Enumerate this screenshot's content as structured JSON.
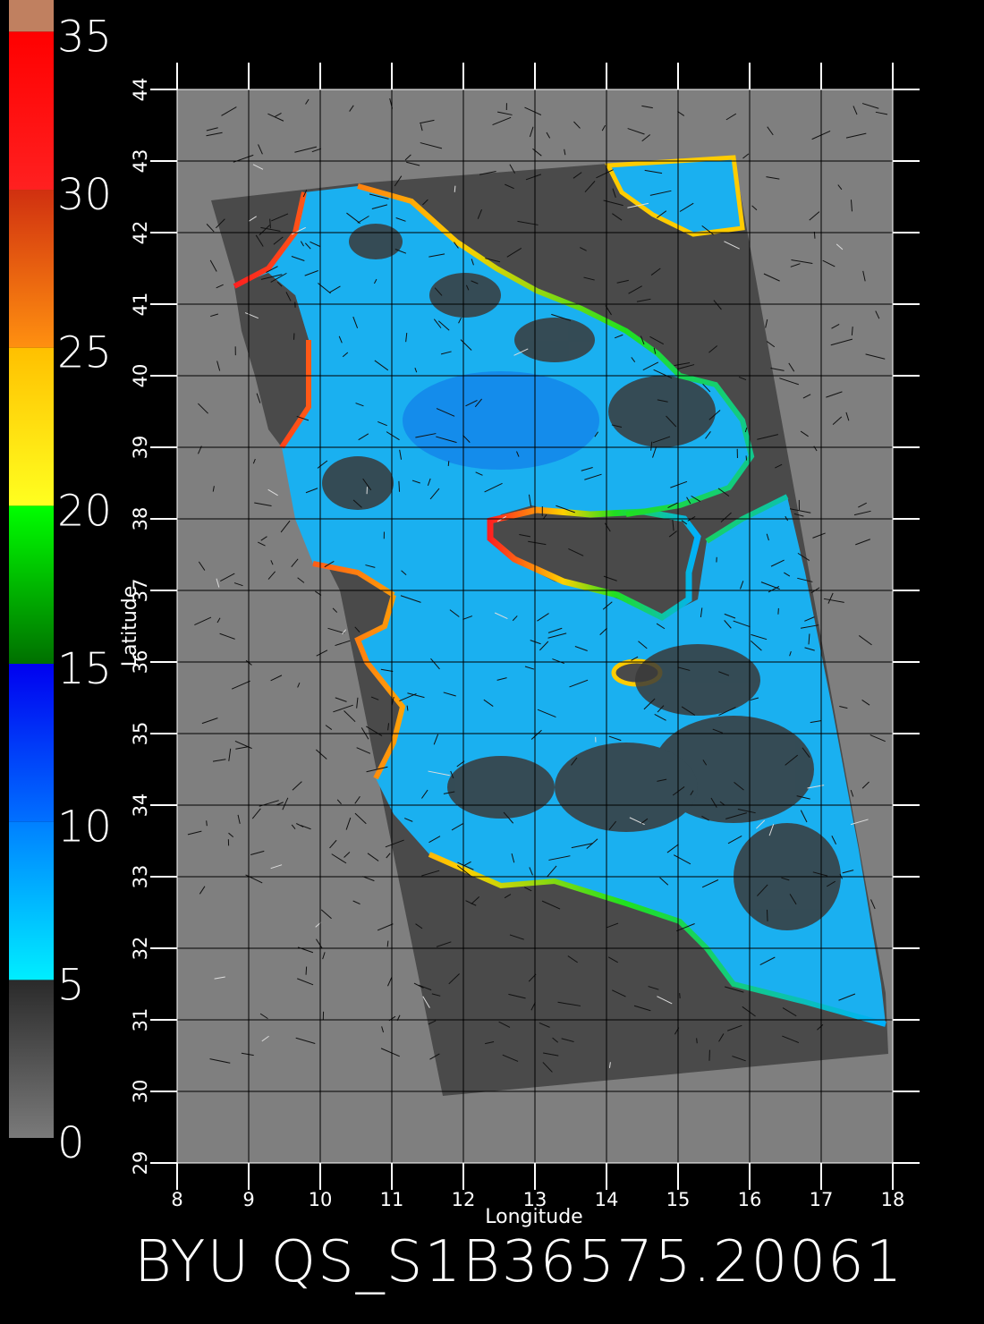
{
  "colorbar": {
    "segments": [
      {
        "from": 0,
        "to": 5,
        "colors": [
          "#7a7a7a",
          "#2a2a2a"
        ]
      },
      {
        "from": 5,
        "to": 10,
        "colors": [
          "#00eeff",
          "#0080ff"
        ]
      },
      {
        "from": 10,
        "to": 15,
        "colors": [
          "#0070ff",
          "#0000f0"
        ]
      },
      {
        "from": 15,
        "to": 20,
        "colors": [
          "#007000",
          "#00ff00"
        ]
      },
      {
        "from": 20,
        "to": 25,
        "colors": [
          "#ffff20",
          "#ffc000"
        ]
      },
      {
        "from": 25,
        "to": 30,
        "colors": [
          "#ff9010",
          "#d03010"
        ]
      },
      {
        "from": 30,
        "to": 35,
        "colors": [
          "#ff2020",
          "#ff0000"
        ]
      },
      {
        "from": 35,
        "to": 36,
        "colors": [
          "#c08060",
          "#c08060"
        ]
      }
    ],
    "labels": [
      "0",
      "5",
      "10",
      "15",
      "20",
      "25",
      "30",
      "35"
    ]
  },
  "map": {
    "lon_range": [
      8,
      18
    ],
    "lat_range": [
      29,
      44
    ],
    "lon_ticks": [
      "8",
      "9",
      "10",
      "11",
      "12",
      "13",
      "14",
      "15",
      "16",
      "17",
      "18"
    ],
    "lat_ticks": [
      "29",
      "30",
      "31",
      "32",
      "33",
      "34",
      "35",
      "36",
      "37",
      "38",
      "39",
      "40",
      "41",
      "42",
      "43",
      "44"
    ],
    "xlabel": "Longitude",
    "ylabel": "Latitude",
    "land_color": "#7f7f7f",
    "swath_color": "#4a4a4a",
    "sea_color": "#1ab0f0",
    "grid_color": "#000000"
  },
  "footer": {
    "title": "BYU QS_S1B36575.20061"
  }
}
